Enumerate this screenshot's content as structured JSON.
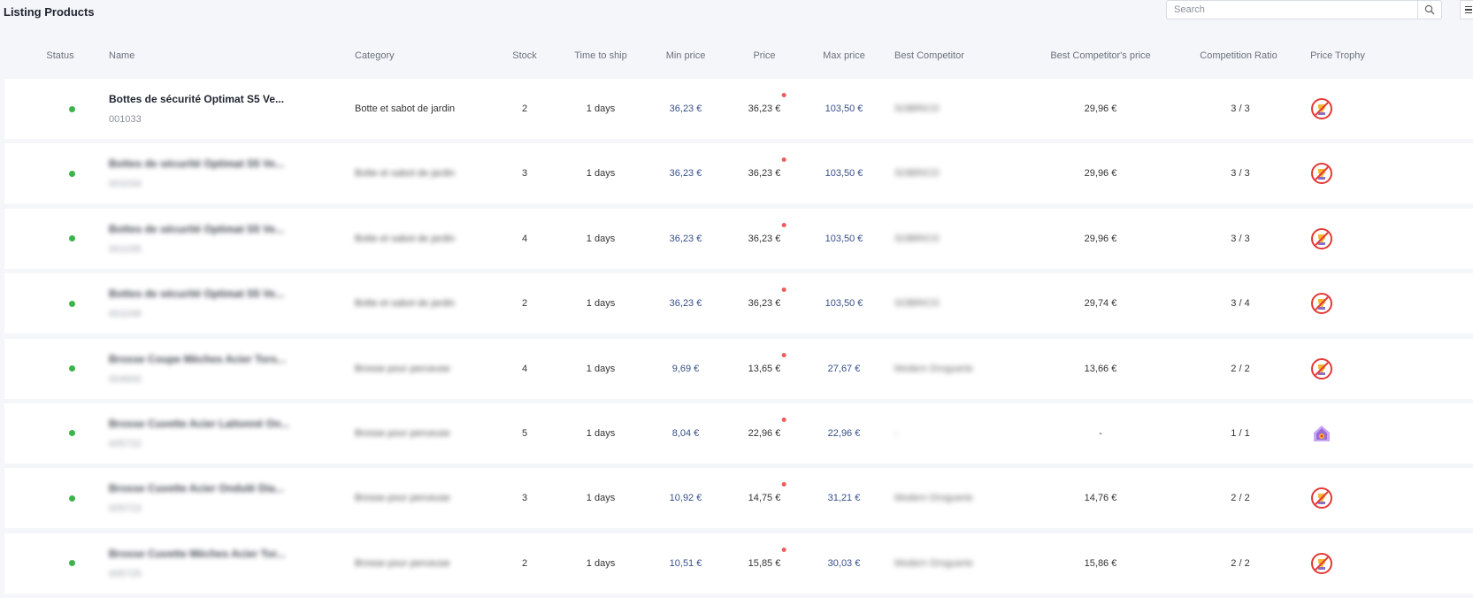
{
  "page_title": "Listing Products",
  "search": {
    "placeholder": "Search"
  },
  "columns": {
    "status": "Status",
    "name": "Name",
    "category": "Category",
    "stock": "Stock",
    "time_to_ship": "Time to ship",
    "min_price": "Min price",
    "price": "Price",
    "max_price": "Max price",
    "best_competitor": "Best Competitor",
    "best_competitor_price": "Best Competitor's price",
    "competition_ratio": "Competition Ratio",
    "price_trophy": "Price Trophy"
  },
  "colors": {
    "status_active": "#3bb54a",
    "price_alert": "#ef5b5b",
    "trophy_lost": "#e53935",
    "trophy_won": "#9c6bd8"
  },
  "rows": [
    {
      "name": "Bottes de sécurité Optimat S5 Ve...",
      "sku": "001033",
      "category": "Botte et sabot de jardin",
      "stock": "2",
      "ship": "1 days",
      "min": "36,23 €",
      "price": "36,23 €",
      "max": "103,50 €",
      "competitor": "SOBRICO",
      "comp_price": "29,96 €",
      "ratio": "3 / 3",
      "trophy": "no-trophy-icon",
      "blurred": false
    },
    {
      "name": "Bottes de sécurité Optimat S5 Ve...",
      "sku": "001034",
      "category": "Botte et sabot de jardin",
      "stock": "3",
      "ship": "1 days",
      "min": "36,23 €",
      "price": "36,23 €",
      "max": "103,50 €",
      "competitor": "SOBRICO",
      "comp_price": "29,96 €",
      "ratio": "3 / 3",
      "trophy": "no-trophy-icon",
      "blurred": true
    },
    {
      "name": "Bottes de sécurité Optimat S5 Ve...",
      "sku": "001035",
      "category": "Botte et sabot de jardin",
      "stock": "4",
      "ship": "1 days",
      "min": "36,23 €",
      "price": "36,23 €",
      "max": "103,50 €",
      "competitor": "SOBRICO",
      "comp_price": "29,96 €",
      "ratio": "3 / 3",
      "trophy": "no-trophy-icon",
      "blurred": true
    },
    {
      "name": "Bottes de sécurité Optimat S5 Ve...",
      "sku": "001036",
      "category": "Botte et sabot de jardin",
      "stock": "2",
      "ship": "1 days",
      "min": "36,23 €",
      "price": "36,23 €",
      "max": "103,50 €",
      "competitor": "SOBRICO",
      "comp_price": "29,74 €",
      "ratio": "3 / 4",
      "trophy": "no-trophy-icon",
      "blurred": true
    },
    {
      "name": "Brosse Coupe Mèches Acier Tors...",
      "sku": "004600",
      "category": "Brosse pour perceuse",
      "stock": "4",
      "ship": "1 days",
      "min": "9,69 €",
      "price": "13,65 €",
      "max": "27,67 €",
      "competitor": "Modern Droguerie",
      "comp_price": "13,66 €",
      "ratio": "2 / 2",
      "trophy": "no-trophy-icon",
      "blurred": true
    },
    {
      "name": "Brosse Cuvette Acier Laitonné On...",
      "sku": "005722",
      "category": "Brosse pour perceuse",
      "stock": "5",
      "ship": "1 days",
      "min": "8,04 €",
      "price": "22,96 €",
      "max": "22,96 €",
      "competitor": "-",
      "comp_price": "-",
      "ratio": "1 / 1",
      "trophy": "trophy-won-icon",
      "blurred": true
    },
    {
      "name": "Brosse Cuvette Acier Ondulé Dia...",
      "sku": "005723",
      "category": "Brosse pour perceuse",
      "stock": "3",
      "ship": "1 days",
      "min": "10,92 €",
      "price": "14,75 €",
      "max": "31,21 €",
      "competitor": "Modern Droguerie",
      "comp_price": "14,76 €",
      "ratio": "2 / 2",
      "trophy": "no-trophy-icon",
      "blurred": true
    },
    {
      "name": "Brosse Cuvette Mèches Acier Tor...",
      "sku": "005725",
      "category": "Brosse pour perceuse",
      "stock": "2",
      "ship": "1 days",
      "min": "10,51 €",
      "price": "15,85 €",
      "max": "30,03 €",
      "competitor": "Modern Droguerie",
      "comp_price": "15,86 €",
      "ratio": "2 / 2",
      "trophy": "no-trophy-icon",
      "blurred": true
    }
  ]
}
